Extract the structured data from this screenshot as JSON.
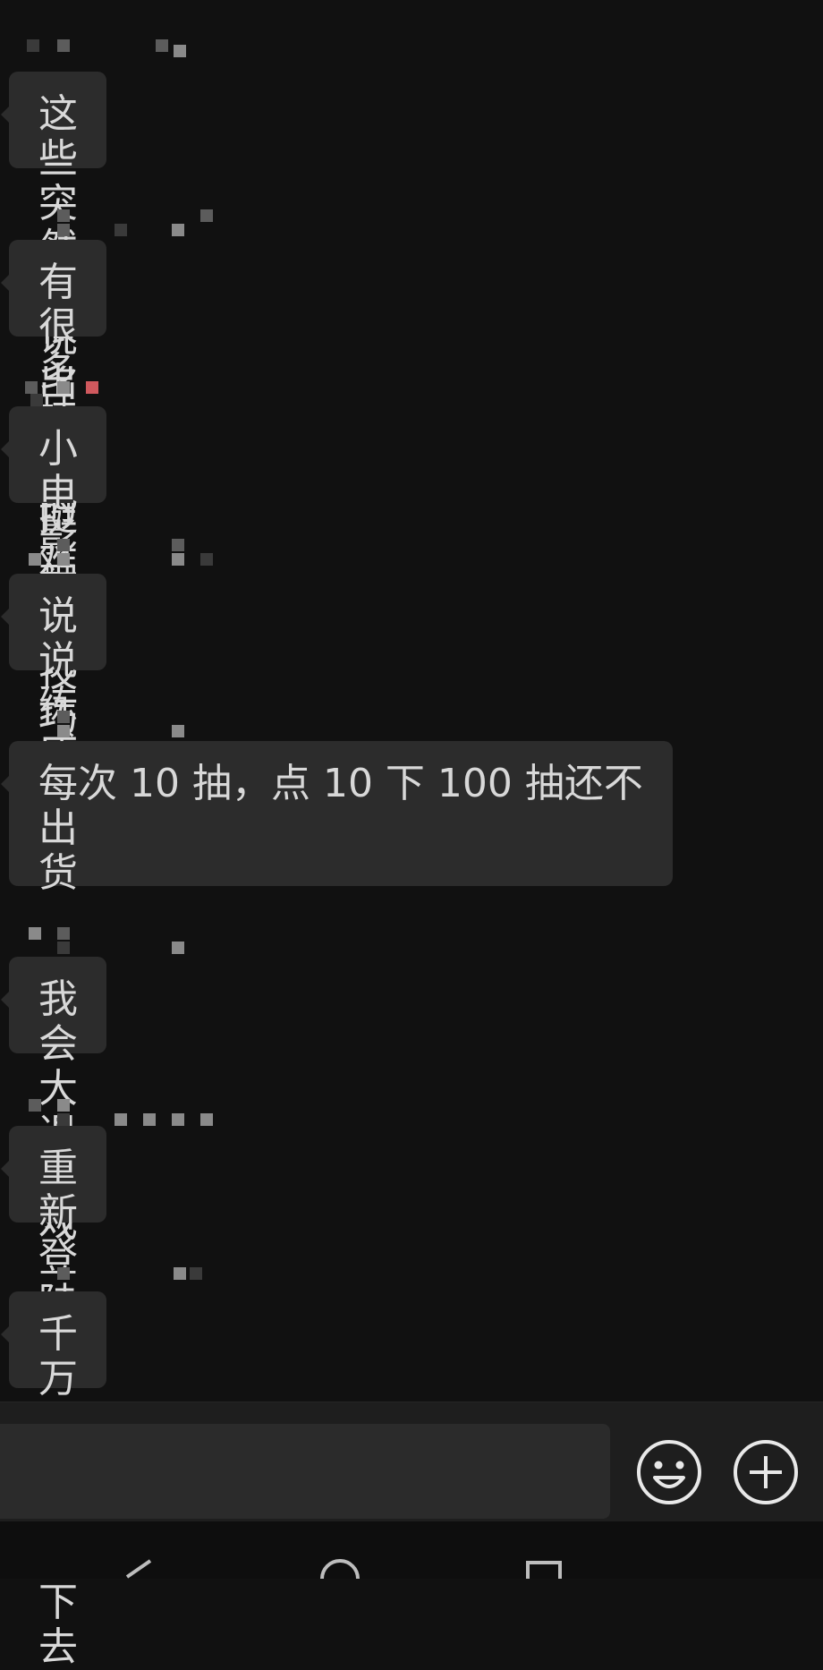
{
  "messages": [
    {
      "text": "这些突然要说出来还挺难"
    },
    {
      "text": "有很多技巧的"
    },
    {
      "text": "小电影配小技巧"
    },
    {
      "text": "说说练成阵吧"
    },
    {
      "text": "每次 10 抽，点 10 下 100 抽还不出\n货"
    },
    {
      "text": "我会大退游戏"
    },
    {
      "text": "重新登陆"
    },
    {
      "text": "千万不要头铁下去"
    }
  ],
  "input": {
    "value": "",
    "placeholder": ""
  },
  "icons": {
    "emoji": "smiley-face-icon",
    "more": "plus-circle-icon",
    "nav_back": "back-triangle-icon",
    "nav_home": "home-circle-icon",
    "nav_recents": "recents-square-icon"
  },
  "colors": {
    "background": "#111111",
    "bubble": "#2c2c2c",
    "text": "#d8d8d8"
  }
}
